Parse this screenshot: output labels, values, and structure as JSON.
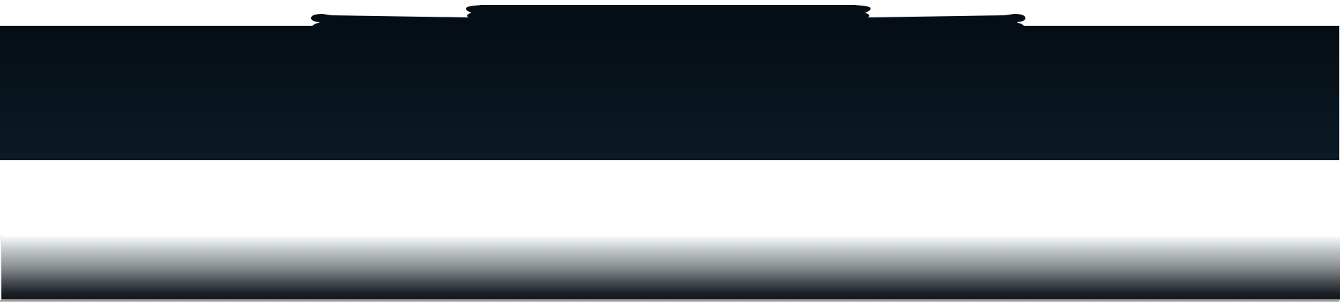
{
  "page": {
    "colors": {
      "header_top": "#050e15",
      "header_bottom": "#0b1a25",
      "content_background": "#ffffff",
      "footer_fade_top": "#ffffff",
      "footer_fade_bottom": "#0f151a",
      "footer_rule": "#9a9a9a"
    },
    "decor": {
      "header_ornament": "tab-with-scroll-flourishes"
    }
  }
}
